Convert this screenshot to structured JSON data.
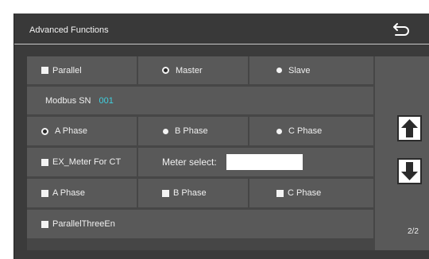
{
  "header": {
    "title": "Advanced Functions",
    "back_icon": "back-arrow-icon"
  },
  "rows": {
    "parallel": {
      "label": "Parallel",
      "checked": true
    },
    "master": {
      "label": "Master",
      "selected": true
    },
    "slave": {
      "label": "Slave",
      "selected": false
    },
    "modbus_sn": {
      "label": "Modbus SN",
      "value": "001"
    },
    "phase_radio": [
      {
        "label": "A Phase",
        "selected": true
      },
      {
        "label": "B Phase",
        "selected": false
      },
      {
        "label": "C Phase",
        "selected": false
      }
    ],
    "ex_meter": {
      "label": "EX_Meter For CT",
      "checked": true
    },
    "meter_select": {
      "label": "Meter select:",
      "value": ""
    },
    "phase_check": [
      {
        "label": "A Phase",
        "checked": true
      },
      {
        "label": "B Phase",
        "checked": true
      },
      {
        "label": "C Phase",
        "checked": true
      }
    ],
    "parallel_three_en": {
      "label": "ParallelThreeEn",
      "checked": true
    }
  },
  "nav": {
    "up_icon": "arrow-up-icon",
    "down_icon": "arrow-down-icon",
    "page": "2/2"
  },
  "colors": {
    "background": "#464646",
    "cell": "#595959",
    "accent": "#3fd0e0"
  }
}
